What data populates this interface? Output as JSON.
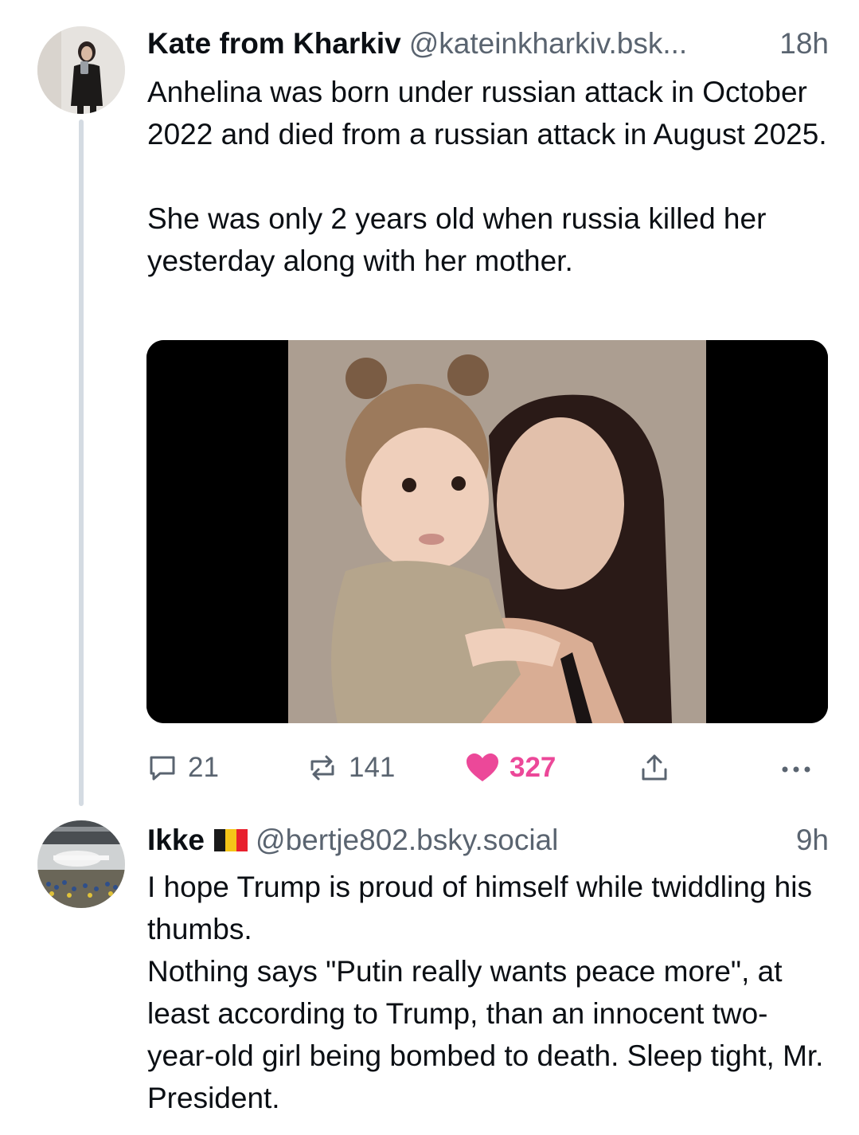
{
  "posts": [
    {
      "author_name": "Kate from Kharkiv",
      "handle": "@kateinkharkiv.bsk...",
      "time": "18h",
      "paragraphs": [
        "Anhelina was born under russian attack in October 2022 and died from a russian attack in August 2025.",
        "She was only 2 years old when russia killed her yesterday along with her mother."
      ],
      "actions": {
        "replies": "21",
        "reposts": "141",
        "likes": "327"
      }
    },
    {
      "author_name": "Ikke",
      "handle": "@bertje802.bsky.social",
      "time": "9h",
      "flag": "belgium-flag",
      "lines": [
        "I hope Trump is proud of himself while twiddling his thumbs.",
        "Nothing says \"Putin really wants peace more\", at least according to Trump, than an innocent two-year-old girl being bombed to death. Sleep tight, Mr. President."
      ]
    }
  ],
  "colors": {
    "like": "#ec4899",
    "muted": "#5a6470",
    "thread_line": "#d4dbe2"
  },
  "icons": [
    "reply-icon",
    "repost-icon",
    "heart-icon",
    "share-icon",
    "more-icon"
  ]
}
